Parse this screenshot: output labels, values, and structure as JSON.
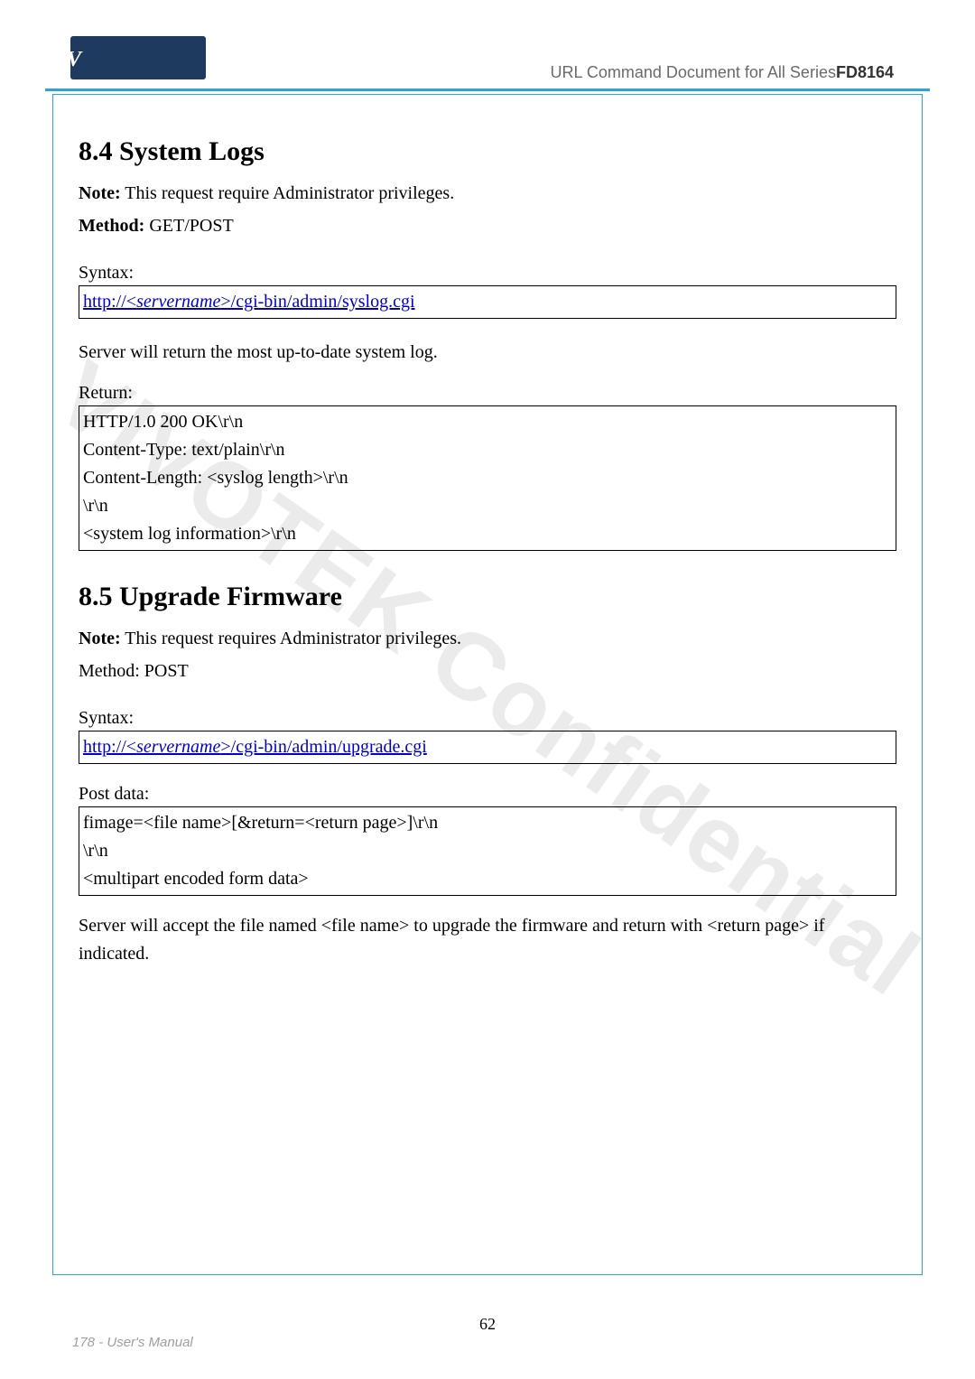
{
  "header": {
    "logo_letter": "V",
    "title_prefix": "URL Command Document for All Series",
    "model": "FD8164"
  },
  "watermark": "VIVOTEK Confidential",
  "sections": {
    "system_logs": {
      "heading": "8.4 System Logs",
      "note_label": "Note:",
      "note_text": " This request require Administrator privileges.",
      "method_label": "Method:",
      "method_value": " GET/POST",
      "syntax_label": "Syntax:",
      "syntax_url_prefix": "http://<",
      "syntax_url_server": "servername",
      "syntax_url_suffix": ">/cgi-bin/admin/syslog.cgi",
      "description": "Server will return the most up-to-date system log.",
      "return_label": "Return:",
      "return_lines": [
        "HTTP/1.0 200 OK\\r\\n",
        "Content-Type: text/plain\\r\\n",
        "Content-Length: <syslog length>\\r\\n",
        "\\r\\n",
        "<system log information>\\r\\n"
      ]
    },
    "upgrade_firmware": {
      "heading": "8.5 Upgrade Firmware",
      "note_label": "Note:",
      "note_text": " This request requires Administrator privileges.",
      "method_line": "Method: POST",
      "syntax_label": "Syntax:",
      "syntax_url_prefix": "http://<",
      "syntax_url_server": "servername",
      "syntax_url_suffix": ">/cgi-bin/admin/upgrade.cgi",
      "post_label": "Post data:",
      "post_lines": [
        "fimage=<file name>[&return=<return page>]\\r\\n",
        "\\r\\n",
        "<multipart encoded form data>"
      ],
      "footer_text": "Server will accept the file named <file name> to upgrade the firmware and return with <return page> if indicated."
    }
  },
  "footer": {
    "left": "178 - User's Manual",
    "center": "62"
  }
}
